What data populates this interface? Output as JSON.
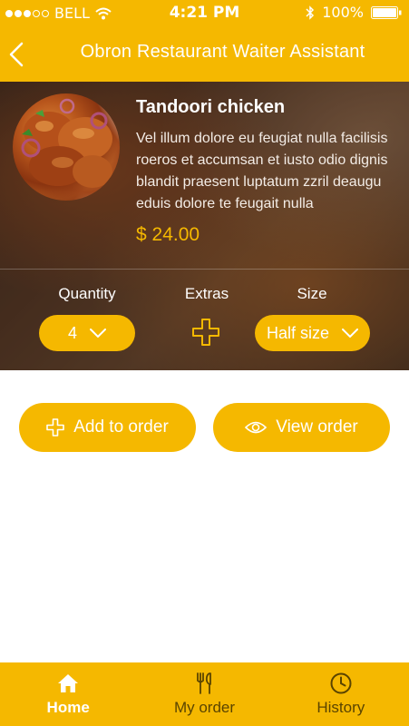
{
  "status_bar": {
    "carrier": "BELL",
    "time": "4:21 PM",
    "battery": "100%"
  },
  "header": {
    "title": "Obron Restaurant Waiter Assistant"
  },
  "dish": {
    "name": "Tandoori chicken",
    "description": "Vel illum dolore eu feugiat nulla facilisis roeros et accumsan et iusto odio dignis blandit praesent luptatum zzril deaugu eduis dolore te feugait nulla",
    "price": "$ 24.00"
  },
  "options": {
    "quantity_label": "Quantity",
    "quantity_value": "4",
    "extras_label": "Extras",
    "size_label": "Size",
    "size_value": "Half size"
  },
  "actions": {
    "add_to_order": "Add to order",
    "view_order": "View order"
  },
  "tabs": [
    {
      "label": "Home",
      "icon": "home-icon",
      "active": true
    },
    {
      "label": "My order",
      "icon": "cutlery-icon",
      "active": false
    },
    {
      "label": "History",
      "icon": "clock-icon",
      "active": false
    }
  ],
  "colors": {
    "accent": "#f5b800",
    "text_on_accent": "#ffffff",
    "inactive_tab": "#5a4400"
  }
}
